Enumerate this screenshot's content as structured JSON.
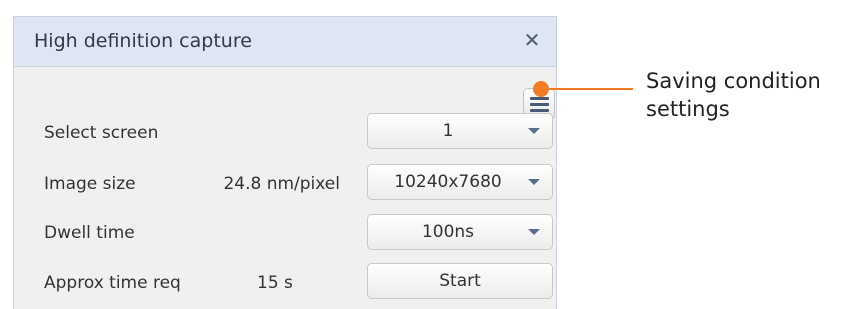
{
  "dialog": {
    "title": "High definition capture",
    "close_symbol": "✕"
  },
  "icons": {
    "menu": "hamburger-menu-icon",
    "close": "close-icon",
    "dropdown": "chevron-down-icon"
  },
  "rows": {
    "select_screen": {
      "label": "Select screen",
      "value": "1"
    },
    "image_size": {
      "label": "Image size",
      "resolution": "24.8 nm/pixel",
      "value": "10240x7680"
    },
    "dwell_time": {
      "label": "Dwell time",
      "value": "100ns"
    },
    "approx_time": {
      "label": "Approx time req",
      "time": "15 s",
      "button": "Start"
    }
  },
  "callout": {
    "line1": "Saving condition",
    "line2": "settings",
    "color": "#f07c26"
  }
}
